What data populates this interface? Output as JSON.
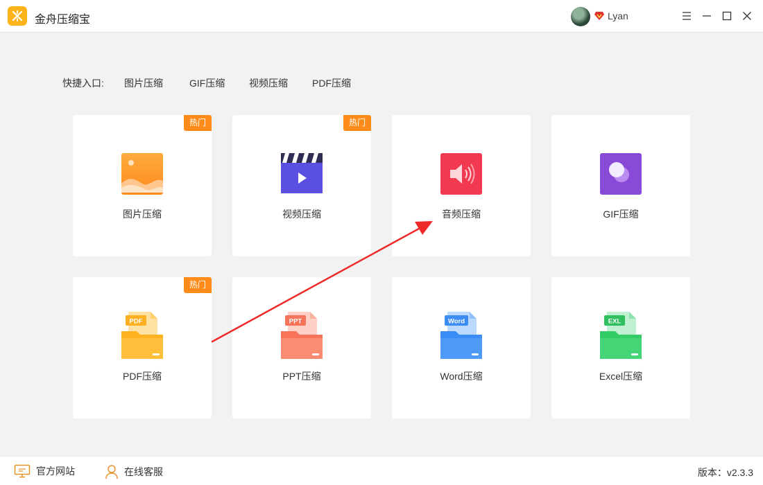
{
  "app": {
    "title": "金舟压缩宝"
  },
  "user": {
    "name": "Lyan"
  },
  "quick": {
    "label": "快捷入口:",
    "links": [
      "图片压缩",
      "GIF压缩",
      "视频压缩",
      "PDF压缩"
    ]
  },
  "badge": "热门",
  "cards": [
    {
      "label": "图片压缩",
      "hot": true
    },
    {
      "label": "视频压缩",
      "hot": true
    },
    {
      "label": "音频压缩",
      "hot": false
    },
    {
      "label": "GIF压缩",
      "hot": false
    },
    {
      "label": "PDF压缩",
      "hot": true,
      "tag": "PDF"
    },
    {
      "label": "PPT压缩",
      "hot": false,
      "tag": "PPT"
    },
    {
      "label": "Word压缩",
      "hot": false,
      "tag": "Word"
    },
    {
      "label": "Excel压缩",
      "hot": false,
      "tag": "EXL"
    }
  ],
  "footer": {
    "website": "官方网站",
    "support": "在线客服",
    "version": "版本：v2.3.3"
  },
  "colors": {
    "accent": "#ff8c1a",
    "image": "#ff9a2e",
    "video": "#5a4fe0",
    "audio": "#f2394f",
    "gif": "#8a4ad8",
    "pdf": "#ffaf1f",
    "ppt": "#f7735a",
    "word": "#3b8cf5",
    "excel": "#33cc66",
    "annotation": "#ee2a2a"
  }
}
